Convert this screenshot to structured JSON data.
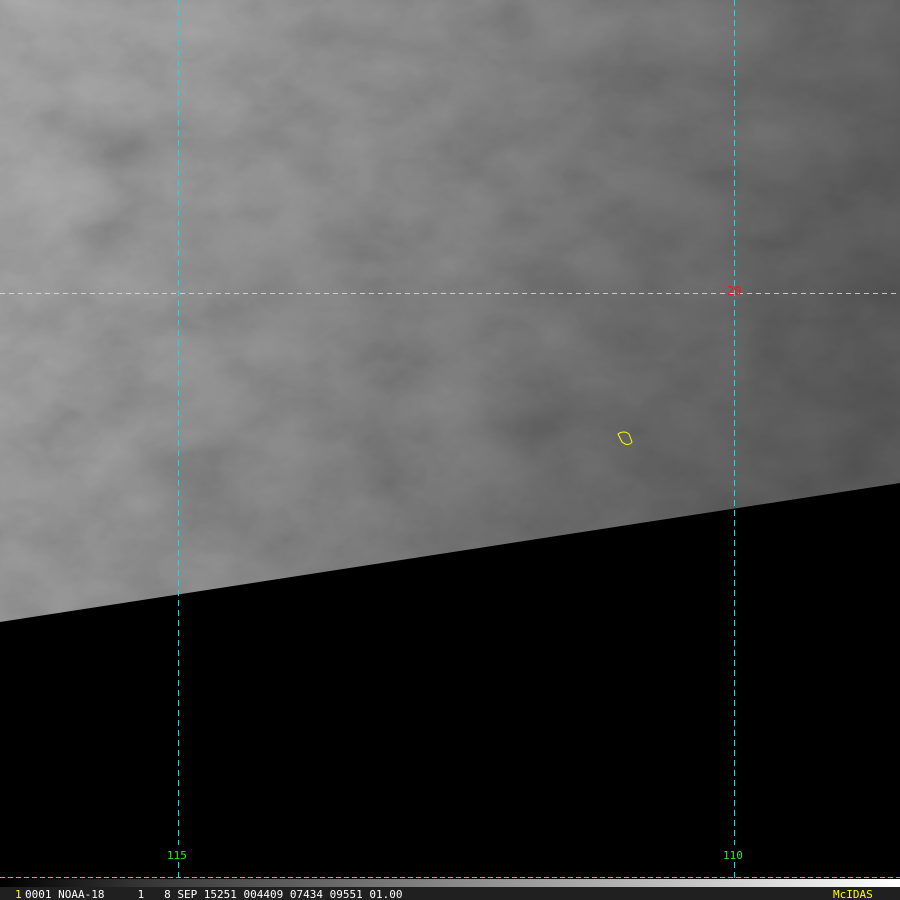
{
  "map": {
    "longitude_labels": [
      "115",
      "110"
    ],
    "latitude_labels": [
      "20"
    ],
    "colors": {
      "grid": "#00e5ee",
      "lon_label": "#22ee22",
      "lat_label": "#ff1010",
      "marker": "#ffff00"
    }
  },
  "status_bar": {
    "frame_number": "1",
    "info": "0001 NOAA-18     1   8 SEP 15251 004409 07434 09551 01.00",
    "brand": "McIDAS"
  }
}
